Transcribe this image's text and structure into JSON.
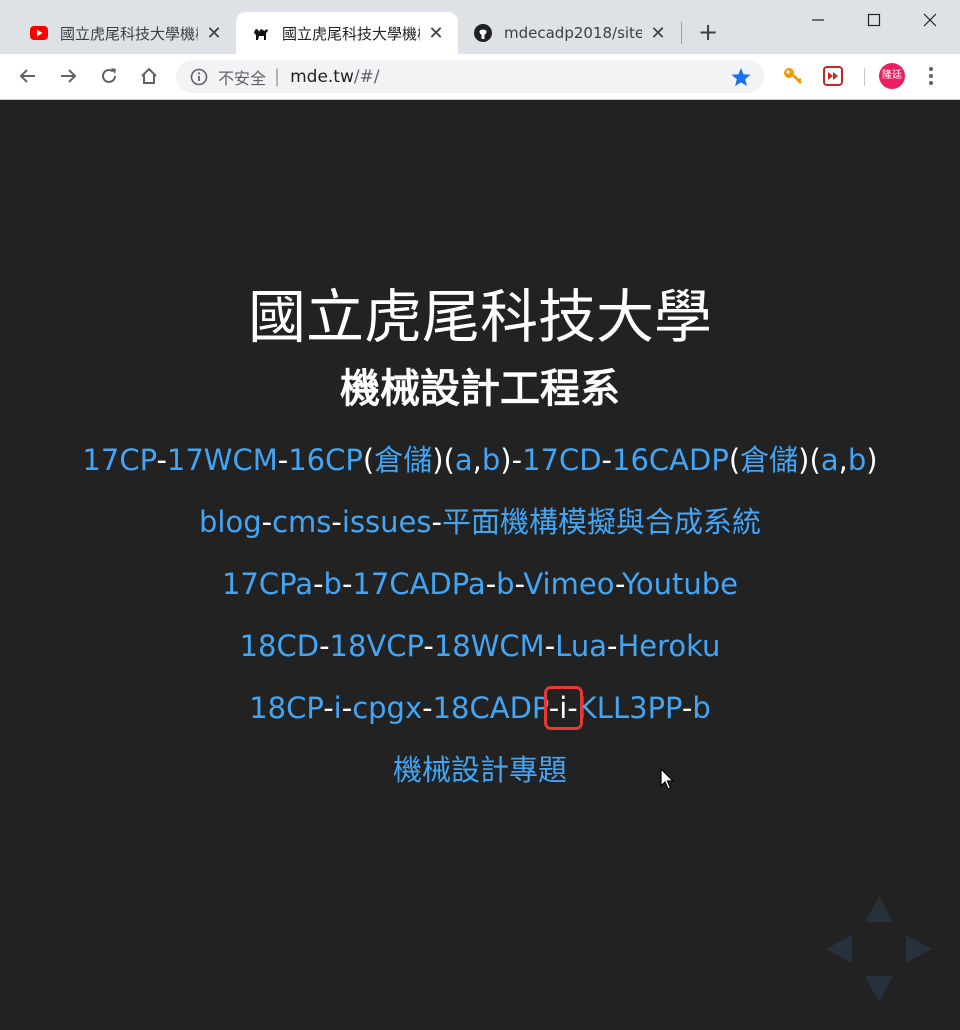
{
  "tabs": [
    {
      "title": "國立虎尾科技大學機械",
      "favicon": "youtube-icon",
      "active": false
    },
    {
      "title": "國立虎尾科技大學機械",
      "favicon": "camel-icon",
      "active": true
    },
    {
      "title": "mdecadp2018/site-",
      "favicon": "github-icon",
      "active": false
    }
  ],
  "new_tab_label": "+",
  "omnibox": {
    "security_label": "不安全",
    "separator": "|",
    "host": "mde.tw",
    "path": "/#/"
  },
  "avatar_text": "隆廷",
  "page": {
    "title": "國立虎尾科技大學",
    "subtitle": "機械設計工程系",
    "rows": [
      [
        {
          "t": "17CP",
          "link": true
        },
        {
          "t": "-",
          "link": false
        },
        {
          "t": "17WCM",
          "link": true
        },
        {
          "t": "-",
          "link": false
        },
        {
          "t": "16CP",
          "link": true
        },
        {
          "t": "(",
          "link": false
        },
        {
          "t": "倉儲",
          "link": true
        },
        {
          "t": ")(",
          "link": false
        },
        {
          "t": "a",
          "link": true
        },
        {
          "t": ",",
          "link": false
        },
        {
          "t": "b",
          "link": true
        },
        {
          "t": ")-",
          "link": false
        },
        {
          "t": "17CD",
          "link": true
        },
        {
          "t": "-",
          "link": false
        },
        {
          "t": "16CADP",
          "link": true
        },
        {
          "t": "(",
          "link": false
        },
        {
          "t": "倉儲",
          "link": true
        },
        {
          "t": ")(",
          "link": false
        },
        {
          "t": "a",
          "link": true
        },
        {
          "t": ",",
          "link": false
        },
        {
          "t": "b",
          "link": true
        },
        {
          "t": ")",
          "link": false
        }
      ],
      [
        {
          "t": "blog",
          "link": true
        },
        {
          "t": "-",
          "link": false
        },
        {
          "t": "cms",
          "link": true
        },
        {
          "t": "-",
          "link": false
        },
        {
          "t": "issues",
          "link": true
        },
        {
          "t": "-",
          "link": false
        },
        {
          "t": "平面機構模擬與合成系統",
          "link": true
        }
      ],
      [
        {
          "t": "17CPa",
          "link": true
        },
        {
          "t": "-",
          "link": false
        },
        {
          "t": "b",
          "link": true
        },
        {
          "t": "-",
          "link": false
        },
        {
          "t": "17CADPa",
          "link": true
        },
        {
          "t": "-",
          "link": false
        },
        {
          "t": "b",
          "link": true
        },
        {
          "t": "-",
          "link": false
        },
        {
          "t": "Vimeo",
          "link": true
        },
        {
          "t": "-",
          "link": false
        },
        {
          "t": "Youtube",
          "link": true
        }
      ],
      [
        {
          "t": "18CD",
          "link": true
        },
        {
          "t": "-",
          "link": false
        },
        {
          "t": "18VCP",
          "link": true
        },
        {
          "t": "-",
          "link": false
        },
        {
          "t": "18WCM",
          "link": true
        },
        {
          "t": "-",
          "link": false
        },
        {
          "t": "Lua",
          "link": true
        },
        {
          "t": "-",
          "link": false
        },
        {
          "t": "Heroku",
          "link": true
        }
      ],
      [
        {
          "t": "18CP",
          "link": true
        },
        {
          "t": "-",
          "link": false
        },
        {
          "t": "i",
          "link": true
        },
        {
          "t": "-",
          "link": false
        },
        {
          "t": "cpgx",
          "link": true
        },
        {
          "t": "-",
          "link": false
        },
        {
          "t": "18CADP",
          "link": true
        },
        {
          "t": "-i-",
          "link": false,
          "highlight": true
        },
        {
          "t": "KLL3PP",
          "link": true
        },
        {
          "t": "-",
          "link": false
        },
        {
          "t": "b",
          "link": true
        }
      ],
      [
        {
          "t": "機械設計專題",
          "link": true
        }
      ]
    ]
  },
  "colors": {
    "page_bg": "#222222",
    "link": "#42a5f5",
    "text": "#ffffff",
    "highlight": "#e53935",
    "star": "#1a73e8",
    "avatar": "#e91e63"
  }
}
